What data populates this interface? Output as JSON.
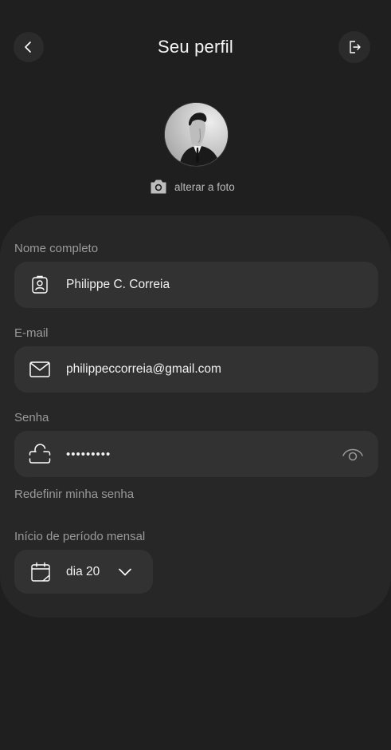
{
  "header": {
    "title": "Seu perfil",
    "back_icon": "chevron-left-icon",
    "logout_icon": "logout-icon"
  },
  "profile": {
    "change_photo_label": "alterar a foto",
    "camera_icon": "camera-icon"
  },
  "form": {
    "name": {
      "label": "Nome completo",
      "value": "Philippe C. Correia",
      "icon": "id-badge-icon"
    },
    "email": {
      "label": "E-mail",
      "value": "philippeccorreia@gmail.com",
      "icon": "mail-icon"
    },
    "password": {
      "label": "Senha",
      "value": "•••••••••",
      "icon": "lock-icon",
      "toggle_icon": "eye-icon"
    },
    "reset_password_label": "Redefinir minha senha",
    "period": {
      "label": "Início de período mensal",
      "value": "dia 20",
      "icon": "calendar-icon",
      "dropdown_icon": "chevron-down-icon"
    }
  },
  "colors": {
    "background": "#1f1f1f",
    "card": "#272727",
    "field": "#323232",
    "label": "#9a9a9a"
  }
}
